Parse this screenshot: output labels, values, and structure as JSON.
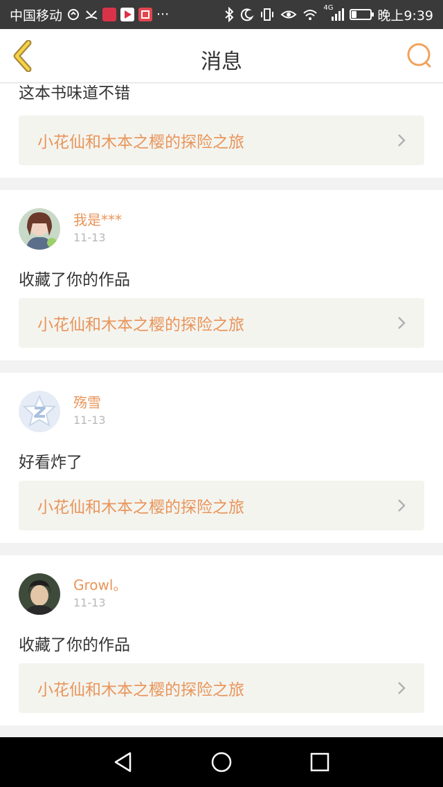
{
  "status_bar": {
    "carrier": "中国移动",
    "dots": "···",
    "time": "晚上9:39",
    "network": "4G",
    "battery_level": 0.25
  },
  "nav": {
    "title": "消息",
    "back_icon": "chevron-left-icon",
    "search_icon": "search-icon",
    "accent_color": "#e8955a"
  },
  "messages": [
    {
      "comment": "这本书味道不错",
      "work_title": "小花仙和木本之樱的探险之旅"
    },
    {
      "username": "我是***",
      "date": "11-13",
      "comment": "收藏了你的作品",
      "work_title": "小花仙和木本之樱的探险之旅"
    },
    {
      "username": "殇雪",
      "date": "11-13",
      "comment": "好看炸了",
      "work_title": "小花仙和木本之樱的探险之旅"
    },
    {
      "username": "Growl。",
      "date": "11-13",
      "comment": "收藏了你的作品",
      "work_title": "小花仙和木本之樱的探险之旅"
    }
  ]
}
